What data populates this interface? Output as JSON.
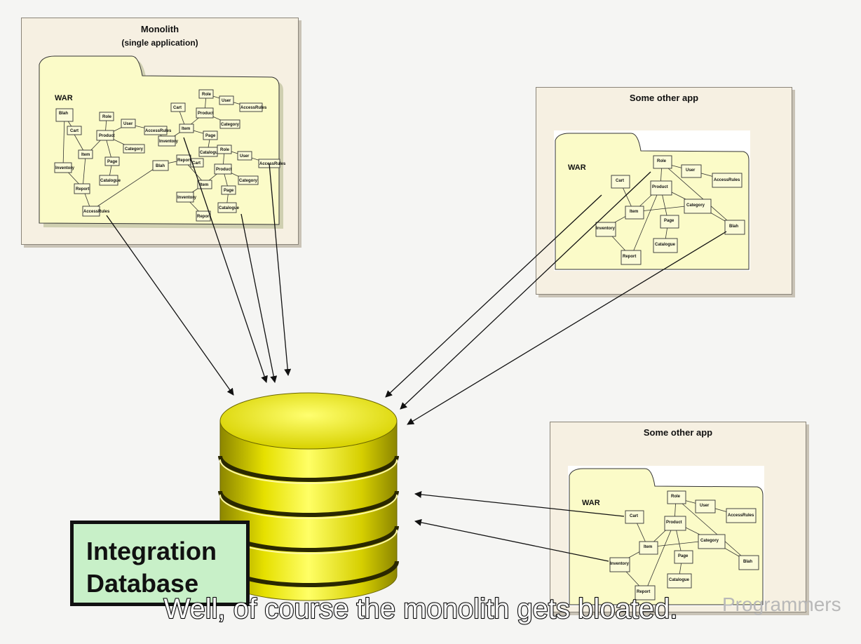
{
  "monolith": {
    "title": "Monolith",
    "subtitle": "(single application)",
    "war_label": "WAR",
    "nodes": [
      "Role",
      "User",
      "AccessRules",
      "Cart",
      "Product",
      "Category",
      "Item",
      "Page",
      "Catalogue",
      "Inventory",
      "Report",
      "Blah"
    ]
  },
  "other_app_1": {
    "title": "Some other app",
    "war_label": "WAR",
    "nodes": [
      "Role",
      "User",
      "AccessRules",
      "Cart",
      "Product",
      "Category",
      "Item",
      "Page",
      "Catalogue",
      "Inventory",
      "Report",
      "Blah"
    ]
  },
  "other_app_2": {
    "title": "Some other app",
    "war_label": "WAR",
    "nodes": [
      "Role",
      "User",
      "AccessRules",
      "Cart",
      "Product",
      "Category",
      "Item",
      "Page",
      "Catalogue",
      "Inventory",
      "Report",
      "Blah"
    ]
  },
  "database": {
    "label_line1": "Integration",
    "label_line2": "Database",
    "color": "#e6e000"
  },
  "caption": "Well, of course the monolith gets bloated.",
  "watermark": "Programmers"
}
